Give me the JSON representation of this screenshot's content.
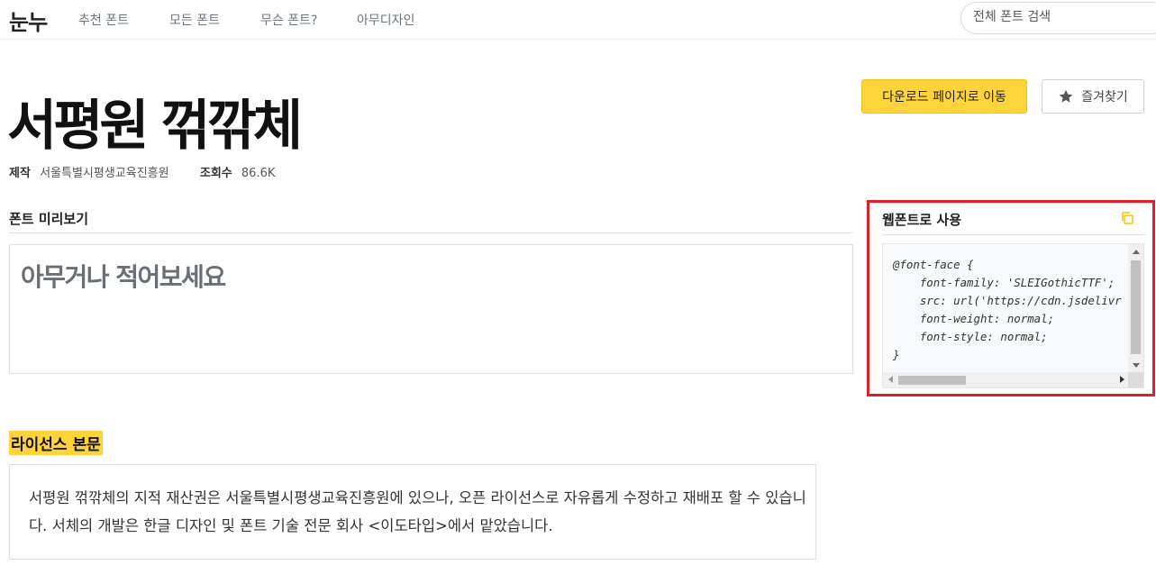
{
  "nav": {
    "logo": "눈누",
    "items": [
      "추천 폰트",
      "모든 폰트",
      "무슨 폰트?",
      "아무디자인"
    ],
    "search_placeholder": "전체 폰트 검색"
  },
  "font": {
    "title": "서평원 꺾깎체",
    "maker_label": "제작",
    "maker": "서울특별시평생교육진흥원",
    "views_label": "조회수",
    "views": "86.6K"
  },
  "actions": {
    "download_label": "다운로드 페이지로 이동",
    "favorite_label": "즐겨찾기"
  },
  "preview": {
    "section_title": "폰트 미리보기",
    "placeholder": "아무거나 적어보세요"
  },
  "webfont": {
    "section_title": "웹폰트로 사용",
    "code": "@font-face {\n    font-family: 'SLEIGothicTTF';\n    src: url('https://cdn.jsdelivr\n    font-weight: normal;\n    font-style: normal;\n}"
  },
  "license": {
    "section_title": "라이선스 본문",
    "body": "서평원 꺾깎체의 지적 재산권은 서울특별시평생교육진흥원에 있으나, 오픈 라이선스로 자유롭게 수정하고 재배포 할 수 있습니다. 서체의 개발은 한글 디자인 및 폰트 기술 전문 회사 <이도타입>에서 맡았습니다."
  },
  "colors": {
    "accent_yellow": "#ffd43b",
    "highlight_red": "#e01e2b"
  }
}
